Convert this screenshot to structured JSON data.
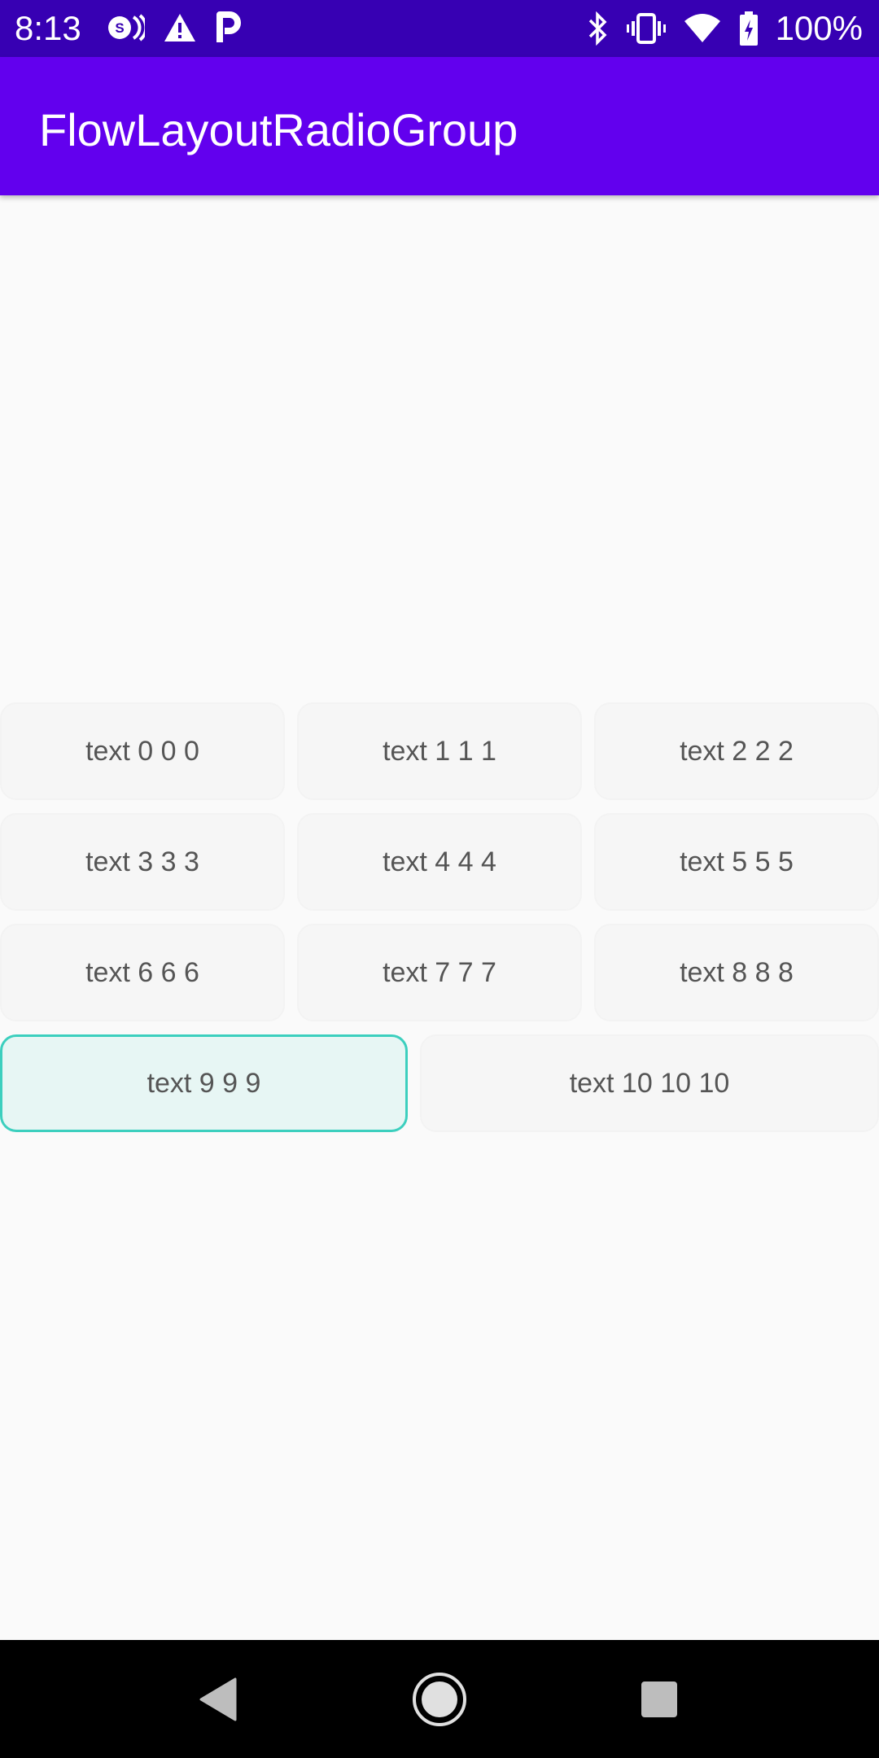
{
  "status_bar": {
    "time": "8:13",
    "battery_percent": "100%",
    "left_icons": [
      "sync-icon",
      "warning-icon",
      "parking-icon"
    ],
    "right_icons": [
      "bluetooth-icon",
      "vibrate-icon",
      "wifi-icon",
      "battery-icon"
    ]
  },
  "app_bar": {
    "title": "FlowLayoutRadioGroup",
    "color": "#6200ee"
  },
  "radio_group": {
    "selected_index": 9,
    "selected_border_color": "#3ccfbe",
    "selected_fill_color": "#e7f6f4",
    "options": [
      {
        "label": "text 0 0 0"
      },
      {
        "label": "text 1 1 1"
      },
      {
        "label": "text 2 2 2"
      },
      {
        "label": "text 3 3 3"
      },
      {
        "label": "text 4 4 4"
      },
      {
        "label": "text 5 5 5"
      },
      {
        "label": "text 6 6 6"
      },
      {
        "label": "text 7 7 7"
      },
      {
        "label": "text 8 8 8"
      },
      {
        "label": "text 9 9 9"
      },
      {
        "label": "text 10 10 10"
      }
    ]
  },
  "nav_bar": {
    "buttons": [
      "back-icon",
      "home-icon",
      "recents-icon"
    ]
  }
}
